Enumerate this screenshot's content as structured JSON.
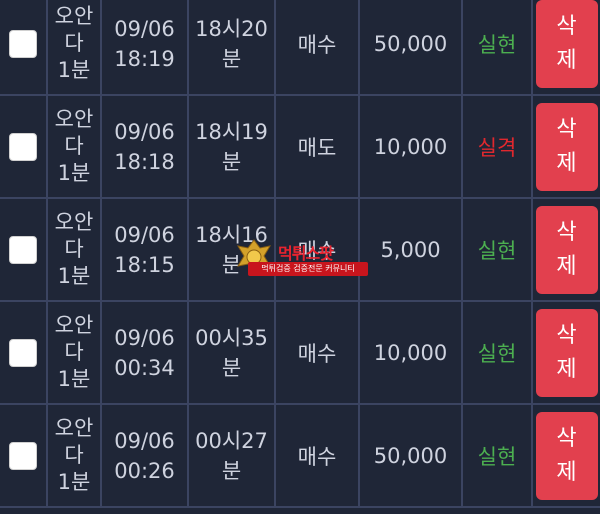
{
  "delete_label_top": "삭",
  "delete_label_bottom": "제",
  "rows": [
    {
      "name_l1": "오안",
      "name_l2": "다",
      "name_l3": "1분",
      "date": "09/06",
      "clock": "18:19",
      "round_l1": "18시20",
      "round_l2": "분",
      "type": "매수",
      "amount": "50,000",
      "result": "실현",
      "result_color": "#4caf50"
    },
    {
      "name_l1": "오안",
      "name_l2": "다",
      "name_l3": "1분",
      "date": "09/06",
      "clock": "18:18",
      "round_l1": "18시19",
      "round_l2": "분",
      "type": "매도",
      "amount": "10,000",
      "result": "실격",
      "result_color": "#e0282e"
    },
    {
      "name_l1": "오안",
      "name_l2": "다",
      "name_l3": "1분",
      "date": "09/06",
      "clock": "18:15",
      "round_l1": "18시16",
      "round_l2": "분",
      "type": "매수",
      "amount": "5,000",
      "result": "실현",
      "result_color": "#4caf50"
    },
    {
      "name_l1": "오안",
      "name_l2": "다",
      "name_l3": "1분",
      "date": "09/06",
      "clock": "00:34",
      "round_l1": "00시35",
      "round_l2": "분",
      "type": "매수",
      "amount": "10,000",
      "result": "실현",
      "result_color": "#4caf50"
    },
    {
      "name_l1": "오안",
      "name_l2": "다",
      "name_l3": "1분",
      "date": "09/06",
      "clock": "00:26",
      "round_l1": "00시27",
      "round_l2": "분",
      "type": "매수",
      "amount": "50,000",
      "result": "실현",
      "result_color": "#4caf50"
    }
  ],
  "watermark": {
    "title": "먹튀스팟",
    "subtitle": "먹튀검증 검증전문 커뮤니티",
    "emblem_icon": "gold-eagle-shield-icon"
  }
}
